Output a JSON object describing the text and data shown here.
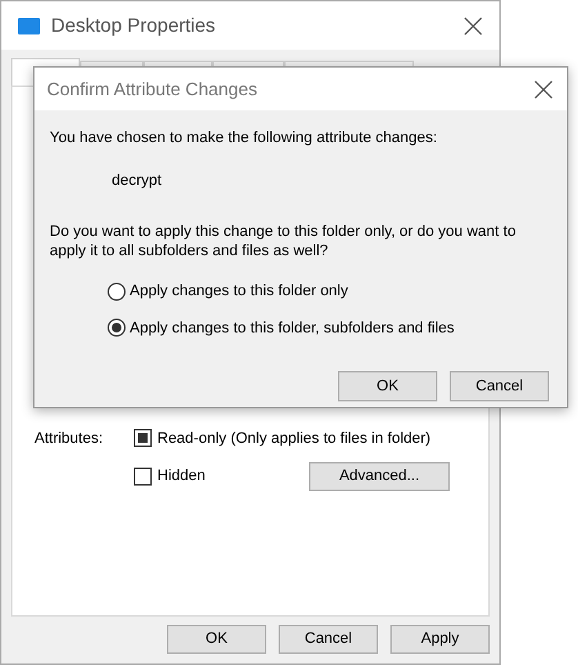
{
  "window": {
    "title": "Desktop Properties"
  },
  "tabs": [
    {
      "selected": true
    },
    {
      "selected": false
    },
    {
      "selected": false
    },
    {
      "selected": false
    },
    {
      "selected": false
    }
  ],
  "attributes": {
    "label": "Attributes:",
    "options": [
      {
        "label": "Read-only (Only applies to files in folder)",
        "checked": true
      },
      {
        "label": "Hidden",
        "checked": false
      }
    ],
    "advanced_button": "Advanced..."
  },
  "buttons": [
    "OK",
    "Cancel",
    "Apply"
  ],
  "dialog": {
    "title": "Confirm Attribute Changes",
    "intro": "You have chosen to make the following attribute changes:",
    "change": "decrypt",
    "question": "Do you want to apply this change to this folder only, or do you want to apply it to all subfolders and files as well?",
    "options": [
      {
        "label": "Apply changes to this folder only",
        "selected": false
      },
      {
        "label": "Apply changes to this folder, subfolders and files",
        "selected": true
      }
    ],
    "buttons": [
      "OK",
      "Cancel"
    ]
  }
}
